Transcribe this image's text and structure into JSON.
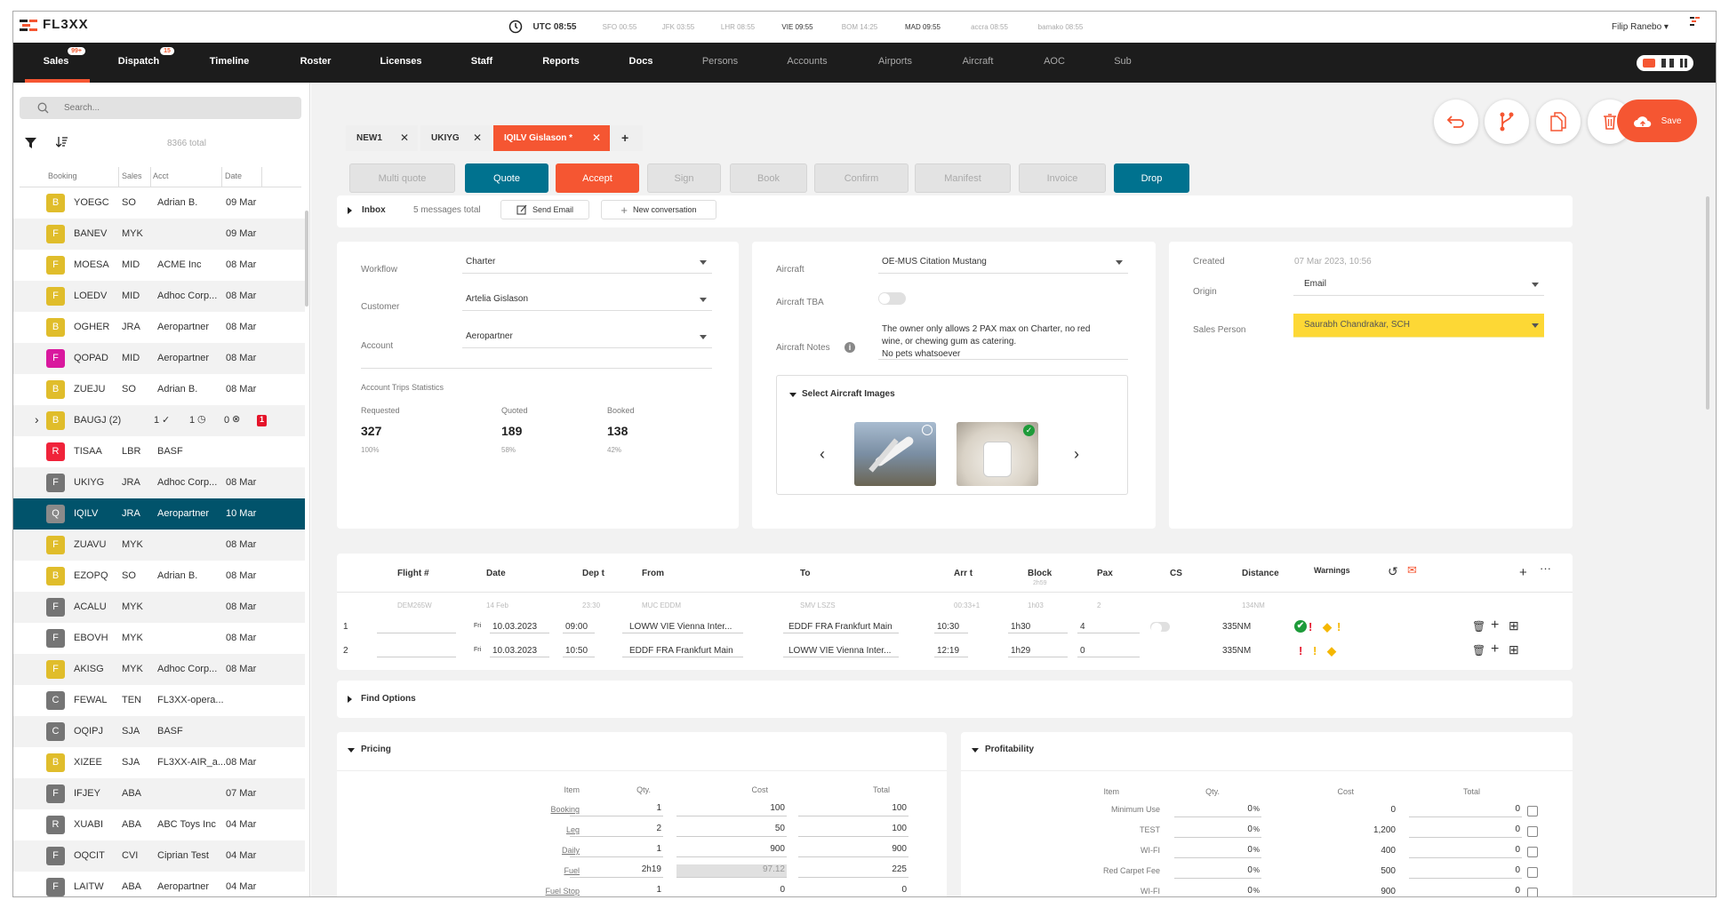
{
  "app": {
    "logo": "FL3XX",
    "user": "Filip Ranebo ▾",
    "small_logo": "FL3XX"
  },
  "clocks": [
    {
      "label": "UTC 08:55",
      "emphasis": "strong"
    },
    {
      "label": "SFO 00:55",
      "emphasis": "dim"
    },
    {
      "label": "JFK 03:55",
      "emphasis": "dim"
    },
    {
      "label": "LHR 08:55",
      "emphasis": "dim"
    },
    {
      "label": "VIE 09:55",
      "emphasis": "dark"
    },
    {
      "label": "BOM 14:25",
      "emphasis": "dim"
    },
    {
      "label": "MAD 09:55",
      "emphasis": "dark"
    },
    {
      "label": "accra 08:55",
      "emphasis": "dim"
    },
    {
      "label": "bamako 08:55",
      "emphasis": "dim"
    }
  ],
  "nav": [
    {
      "label": "Sales",
      "badge": "99+",
      "active": true
    },
    {
      "label": "Dispatch",
      "badge": "15"
    },
    {
      "label": "Timeline"
    },
    {
      "label": "Roster"
    },
    {
      "label": "Licenses"
    },
    {
      "label": "Staff"
    },
    {
      "label": "Reports"
    },
    {
      "label": "Docs"
    },
    {
      "label": "Persons",
      "dim": true
    },
    {
      "label": "Accounts",
      "dim": true
    },
    {
      "label": "Airports",
      "dim": true
    },
    {
      "label": "Aircraft",
      "dim": true
    },
    {
      "label": "AOC",
      "dim": true
    },
    {
      "label": "Sub",
      "dim": true
    }
  ],
  "colors": {
    "accent": "#f55632",
    "primary": "#00728f",
    "selected_row": "#01536b",
    "badge_yellow": "#e0bd2b",
    "badge_magenta": "#d9189e",
    "badge_red": "#f0233a",
    "badge_gray": "#757575",
    "sales_person_bg": "#fdd835"
  },
  "sidebar": {
    "search_placeholder": "Search...",
    "total": "8366 total",
    "columns": [
      "Booking",
      "Sales",
      "Acct",
      "Date"
    ],
    "rows": [
      {
        "badge": "B",
        "color": "yellow",
        "code": "YOEGC",
        "sales": "SO",
        "acct": "Adrian B.",
        "date": "09 Mar"
      },
      {
        "badge": "F",
        "color": "yellow",
        "code": "BANEV",
        "sales": "MYK",
        "acct": "",
        "date": "09 Mar"
      },
      {
        "badge": "F",
        "color": "yellow",
        "code": "MOESA",
        "sales": "MID",
        "acct": "ACME Inc",
        "date": "08 Mar"
      },
      {
        "badge": "F",
        "color": "yellow",
        "code": "LOEDV",
        "sales": "MID",
        "acct": "Adhoc Corp...",
        "date": "08 Mar"
      },
      {
        "badge": "B",
        "color": "yellow",
        "code": "OGHER",
        "sales": "JRA",
        "acct": "Aeropartner",
        "date": "08 Mar"
      },
      {
        "badge": "F",
        "color": "magenta",
        "code": "QOPAD",
        "sales": "MID",
        "acct": "Aeropartner",
        "date": "08 Mar"
      },
      {
        "badge": "B",
        "color": "yellow",
        "code": "ZUEJU",
        "sales": "SO",
        "acct": "Adrian B.",
        "date": "08 Mar"
      },
      {
        "badge": "B",
        "color": "yellow",
        "code": "BAUGJ (2)",
        "group": true,
        "confirmed": "1",
        "pending": "1",
        "cancelled": "0",
        "alerts": "1"
      },
      {
        "badge": "R",
        "color": "red",
        "code": "TISAA",
        "sales": "LBR",
        "acct": "BASF",
        "date": ""
      },
      {
        "badge": "F",
        "color": "gray",
        "code": "UKIYG",
        "sales": "JRA",
        "acct": "Adhoc Corp...",
        "date": "08 Mar"
      },
      {
        "badge": "Q",
        "color": "gray",
        "code": "IQILV",
        "sales": "JRA",
        "acct": "Aeropartner",
        "date": "10 Mar",
        "selected": true
      },
      {
        "badge": "F",
        "color": "yellow",
        "code": "ZUAVU",
        "sales": "MYK",
        "acct": "",
        "date": "08 Mar"
      },
      {
        "badge": "B",
        "color": "yellow",
        "code": "EZOPQ",
        "sales": "SO",
        "acct": "Adrian B.",
        "date": "08 Mar"
      },
      {
        "badge": "F",
        "color": "gray",
        "code": "ACALU",
        "sales": "MYK",
        "acct": "",
        "date": "08 Mar"
      },
      {
        "badge": "F",
        "color": "gray",
        "code": "EBOVH",
        "sales": "MYK",
        "acct": "",
        "date": "08 Mar"
      },
      {
        "badge": "F",
        "color": "yellow",
        "code": "AKISG",
        "sales": "MYK",
        "acct": "Adhoc Corp...",
        "date": "08 Mar"
      },
      {
        "badge": "C",
        "color": "gray",
        "code": "FEWAL",
        "sales": "TEN",
        "acct": "FL3XX-opera...",
        "date": ""
      },
      {
        "badge": "C",
        "color": "gray",
        "code": "OQIPJ",
        "sales": "SJA",
        "acct": "BASF",
        "date": ""
      },
      {
        "badge": "B",
        "color": "yellow",
        "code": "XIZEE",
        "sales": "SJA",
        "acct": "FL3XX-AIR_a...",
        "date": "08 Mar"
      },
      {
        "badge": "F",
        "color": "gray",
        "code": "IFJEY",
        "sales": "ABA",
        "acct": "",
        "date": "07 Mar"
      },
      {
        "badge": "R",
        "color": "gray",
        "code": "XUABI",
        "sales": "ABA",
        "acct": "ABC Toys Inc",
        "date": "04 Mar"
      },
      {
        "badge": "F",
        "color": "gray",
        "code": "OQCIT",
        "sales": "CVI",
        "acct": "Ciprian Test",
        "date": "04 Mar"
      },
      {
        "badge": "F",
        "color": "gray",
        "code": "LAITW",
        "sales": "ABA",
        "acct": "Aeropartner",
        "date": "04 Mar"
      }
    ]
  },
  "tabs": [
    {
      "label": "NEW1"
    },
    {
      "label": "UKIYG"
    },
    {
      "label": "IQILV Gislason *",
      "active": true
    }
  ],
  "tab_add": "+",
  "actions": {
    "save": "Save"
  },
  "workflow_buttons": [
    {
      "label": "Multi quote",
      "state": "disabled"
    },
    {
      "label": "Quote",
      "state": "primary"
    },
    {
      "label": "Accept",
      "state": "accent"
    },
    {
      "label": "Sign",
      "state": "disabled"
    },
    {
      "label": "Book",
      "state": "disabled"
    },
    {
      "label": "Confirm",
      "state": "disabled"
    },
    {
      "label": "Manifest",
      "state": "disabled"
    },
    {
      "label": "Invoice",
      "state": "disabled"
    },
    {
      "label": "Drop",
      "state": "primary"
    }
  ],
  "inbox": {
    "title": "Inbox",
    "count": "5 messages total",
    "send_email": "Send Email",
    "new_conversation": "New conversation"
  },
  "trip": {
    "workflow_label": "Workflow",
    "workflow": "Charter",
    "customer_label": "Customer",
    "customer": "Artelia Gislason",
    "account_label": "Account",
    "account": "Aeropartner",
    "stats_title": "Account Trips Statistics",
    "stats": [
      {
        "label": "Requested",
        "value": "327",
        "pct": "100%"
      },
      {
        "label": "Quoted",
        "value": "189",
        "pct": "58%"
      },
      {
        "label": "Booked",
        "value": "138",
        "pct": "42%"
      }
    ]
  },
  "aircraft": {
    "aircraft_label": "Aircraft",
    "aircraft": "OE-MUS Citation Mustang",
    "tba_label": "Aircraft TBA",
    "tba_on": false,
    "notes_label": "Aircraft Notes",
    "notes": [
      "The owner only allows 2 PAX max on Charter, no red",
      "wine, or chewing gum as catering.",
      "No pets whatsoever"
    ],
    "images_title": "Select Aircraft Images",
    "images": [
      {
        "subject": "exterior",
        "selected": false
      },
      {
        "subject": "cabin",
        "selected": true
      }
    ]
  },
  "meta": {
    "created_label": "Created",
    "created": "07 Mar 2023, 10:56",
    "origin_label": "Origin",
    "origin": "Email",
    "sales_person_label": "Sales Person",
    "sales_person": "Saurabh Chandrakar, SCH"
  },
  "flights": {
    "headers": {
      "flight": "Flight #",
      "date": "Date",
      "dep": "Dep t",
      "from": "From",
      "to": "To",
      "arr": "Arr t",
      "block": "Block",
      "block_total": "2h59",
      "pax": "Pax",
      "cs": "CS",
      "distance": "Distance",
      "warnings": "Warnings"
    },
    "previous": {
      "flight": "DEM265W",
      "date": "14 Feb",
      "dep": "23:30",
      "from": "MUC EDDM",
      "to": "SMV LSZS",
      "arr": "00:33+1",
      "block": "1h03",
      "pax": "2",
      "distance": "134NM"
    },
    "legs": [
      {
        "n": "1",
        "flight": "",
        "day": "Fri",
        "date": "10.03.2023",
        "dep": "09:00",
        "from": "LOWW VIE Vienna Inter...",
        "to": "EDDF FRA Frankfurt Main",
        "arr": "10:30",
        "block": "1h30",
        "pax": "4",
        "cs": false,
        "distance": "335NM",
        "warnings": [
          "ok",
          "error",
          "tag",
          "warn"
        ]
      },
      {
        "n": "2",
        "flight": "",
        "day": "Fri",
        "date": "10.03.2023",
        "dep": "10:50",
        "from": "EDDF FRA Frankfurt Main",
        "to": "LOWW VIE Vienna Inter...",
        "arr": "12:19",
        "block": "1h29",
        "pax": "0",
        "distance": "335NM",
        "warnings": [
          "error",
          "warn",
          "tag"
        ]
      }
    ]
  },
  "find_options": "Find Options",
  "pricing": {
    "title": "Pricing",
    "headers": [
      "Item",
      "Qty.",
      "Cost",
      "Total"
    ],
    "rows": [
      {
        "item": "Booking",
        "qty": "1",
        "cost": "100",
        "total": "100"
      },
      {
        "item": "Leg",
        "qty": "2",
        "cost": "50",
        "total": "100"
      },
      {
        "item": "Daily",
        "qty": "1",
        "cost": "900",
        "total": "900"
      },
      {
        "item": "Fuel",
        "qty": "2h19",
        "cost": "97.12",
        "total": "225",
        "cost_readonly": true
      },
      {
        "item": "Fuel Stop",
        "qty": "1",
        "cost": "0",
        "total": "0"
      }
    ]
  },
  "profitability": {
    "title": "Profitability",
    "headers": [
      "Item",
      "Qty.",
      "Cost",
      "Total"
    ],
    "rows": [
      {
        "item": "Minimum Use",
        "qty": "0",
        "unit": "%",
        "cost": "0",
        "total": "0"
      },
      {
        "item": "TEST",
        "qty": "0",
        "unit": "%",
        "cost": "1,200",
        "total": "0"
      },
      {
        "item": "WI-FI",
        "qty": "0",
        "unit": "%",
        "cost": "400",
        "total": "0"
      },
      {
        "item": "Red Carpet Fee",
        "qty": "0",
        "unit": "%",
        "cost": "500",
        "total": "0"
      },
      {
        "item": "WI-FI",
        "qty": "0",
        "unit": "%",
        "cost": "900",
        "total": "0"
      }
    ]
  }
}
